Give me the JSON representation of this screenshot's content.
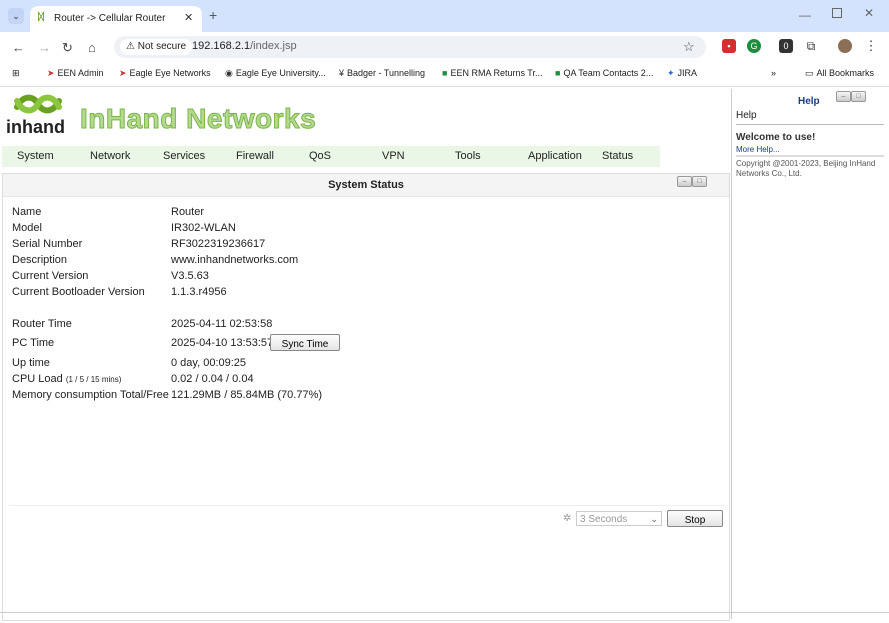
{
  "browser": {
    "tab_title": "Router -> Cellular Router",
    "not_secure_label": "Not secure",
    "url_host": "192.168.2.1",
    "url_path": "/index.jsp",
    "all_bookmarks": "All Bookmarks",
    "bookmarks": [
      {
        "label": "EEN Admin"
      },
      {
        "label": "Eagle Eye Networks"
      },
      {
        "label": "Eagle Eye University..."
      },
      {
        "label": "Badger - Tunnelling"
      },
      {
        "label": "EEN RMA Returns Tr..."
      },
      {
        "label": "QA Team Contacts 2..."
      },
      {
        "label": "JIRA"
      }
    ]
  },
  "header": {
    "logo_text": "inhand",
    "brand": "InHand Networks"
  },
  "menu": [
    {
      "label": "System"
    },
    {
      "label": "Network"
    },
    {
      "label": "Services"
    },
    {
      "label": "Firewall"
    },
    {
      "label": "QoS"
    },
    {
      "label": "VPN"
    },
    {
      "label": "Tools"
    },
    {
      "label": "Application"
    },
    {
      "label": "Status"
    }
  ],
  "status": {
    "title": "System Status",
    "rows": [
      {
        "label": "Name",
        "value": "Router"
      },
      {
        "label": "Model",
        "value": "IR302-WLAN"
      },
      {
        "label": "Serial Number",
        "value": "RF3022319236617"
      },
      {
        "label": "Description",
        "value": "www.inhandnetworks.com"
      },
      {
        "label": "Current Version",
        "value": "V3.5.63"
      },
      {
        "label": "Current Bootloader Version",
        "value": "1.1.3.r4956"
      },
      {
        "label": "Router Time",
        "value": "2025-04-11 02:53:58"
      },
      {
        "label": "PC Time",
        "value": "2025-04-10 13:53:57"
      },
      {
        "label": "Up time",
        "value": "0 day, 00:09:25"
      },
      {
        "label": "CPU Load",
        "label_small": "(1 / 5 / 15 mins)",
        "value": "0.02 / 0.04 / 0.04"
      },
      {
        "label": "Memory consumption Total/Free",
        "value": "121.29MB / 85.84MB (70.77%)"
      }
    ],
    "sync_button": "Sync Time",
    "refresh_select": "3 Seconds",
    "stop_button": "Stop"
  },
  "help": {
    "title": "Help",
    "label": "Help",
    "welcome": "Welcome to use!",
    "more_help": "More Help...",
    "copyright": "Copyright @2001-2023, Beijing InHand Networks Co., Ltd."
  }
}
